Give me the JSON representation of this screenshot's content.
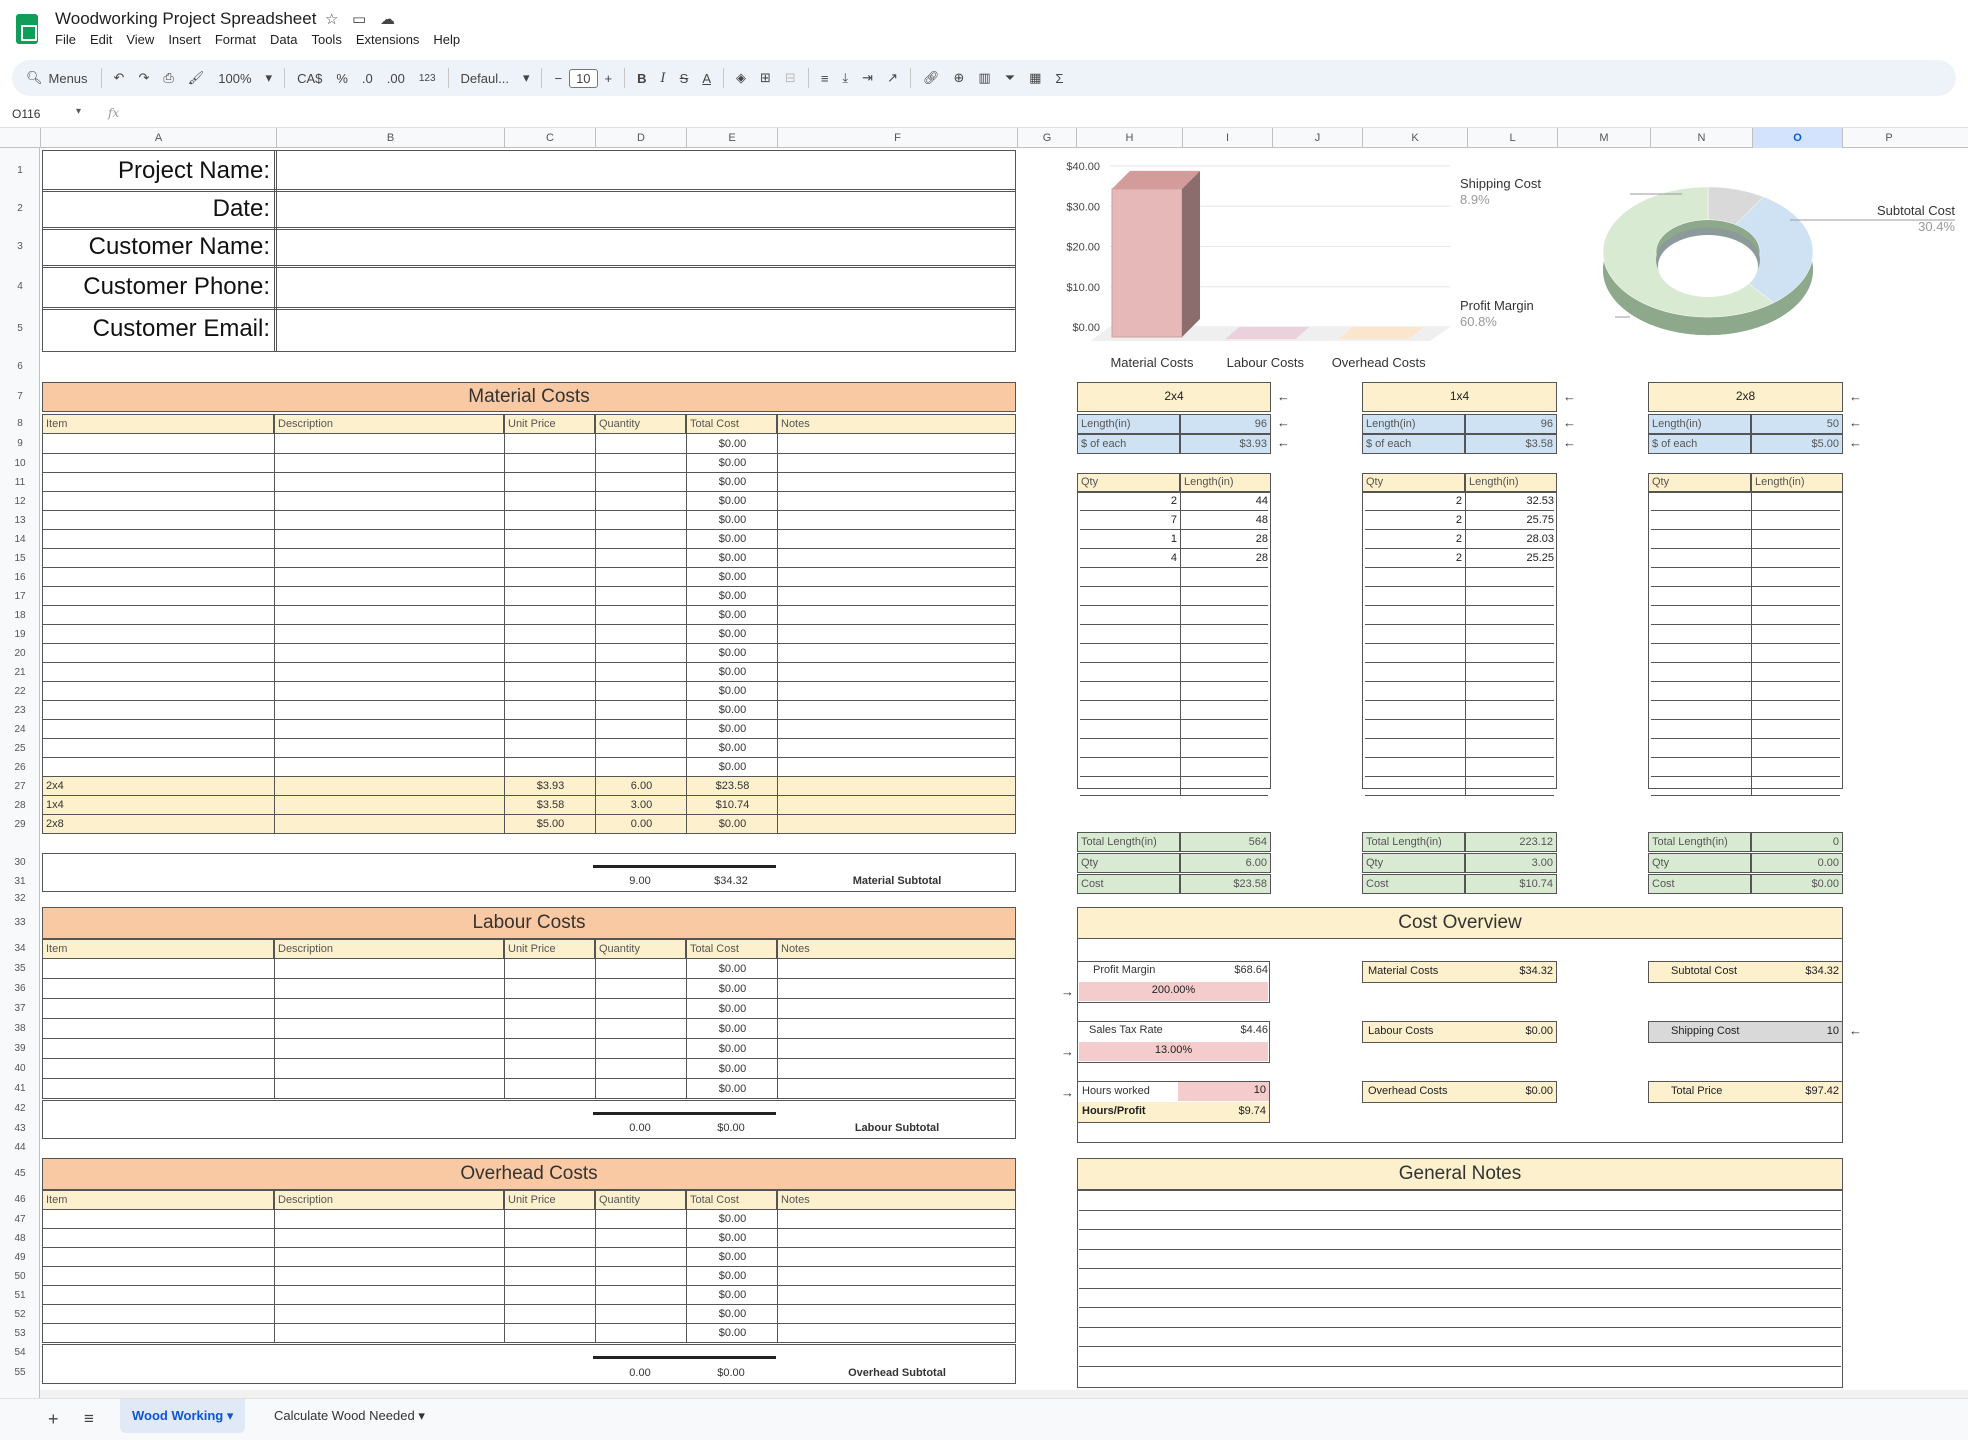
{
  "doc": {
    "title": "Woodworking Project Spreadsheet"
  },
  "menu": [
    "File",
    "Edit",
    "View",
    "Insert",
    "Format",
    "Data",
    "Tools",
    "Extensions",
    "Help"
  ],
  "toolbar": {
    "menus": "Menus",
    "zoom": "100%",
    "currency": "CA$",
    "percent": "%",
    "dec_less": ".0",
    "dec_more": ".00",
    "number_fmt": "123",
    "font": "Defaul...",
    "font_size": "10",
    "bold": "B",
    "italic": "I",
    "strike": "S",
    "textcolor": "A"
  },
  "formula": {
    "namebox": "O116",
    "fx": "fx"
  },
  "columns": [
    "A",
    "B",
    "C",
    "D",
    "E",
    "F",
    "G",
    "H",
    "I",
    "J",
    "K",
    "L",
    "M",
    "N",
    "O",
    "P"
  ],
  "selected_column": "O",
  "rows": [
    "1",
    "2",
    "3",
    "4",
    "5",
    "6",
    "7",
    "8",
    "9",
    "10",
    "11",
    "12",
    "13",
    "14",
    "15",
    "16",
    "17",
    "18",
    "19",
    "20",
    "21",
    "22",
    "23",
    "24",
    "25",
    "26",
    "27",
    "28",
    "29",
    "30",
    "31",
    "32",
    "33",
    "34",
    "35",
    "36",
    "37",
    "38",
    "39",
    "40",
    "41",
    "42",
    "43",
    "44",
    "45",
    "46",
    "47",
    "48",
    "49",
    "50",
    "51",
    "52",
    "53",
    "54",
    "55"
  ],
  "header_fields": [
    "Project Name:",
    "Date:",
    "Customer Name:",
    "Customer Phone:",
    "Customer Email:"
  ],
  "material": {
    "title": "Material Costs",
    "cols": [
      "Item",
      "Description",
      "Unit Price",
      "Quantity",
      "Total Cost",
      "Notes"
    ],
    "zero": "$0.00",
    "wood_rows": [
      {
        "item": "2x4",
        "price": "$3.93",
        "qty": "6.00",
        "total": "$23.58"
      },
      {
        "item": "1x4",
        "price": "$3.58",
        "qty": "3.00",
        "total": "$10.74"
      },
      {
        "item": "2x8",
        "price": "$5.00",
        "qty": "0.00",
        "total": "$0.00"
      }
    ],
    "sub_qty": "9.00",
    "sub_total": "$34.32",
    "sub_label": "Material Subtotal"
  },
  "labour": {
    "title": "Labour Costs",
    "cols": [
      "Item",
      "Description",
      "Unit Price",
      "Quantity",
      "Total Cost",
      "Notes"
    ],
    "zero": "$0.00",
    "sub_qty": "0.00",
    "sub_total": "$0.00",
    "sub_label": "Labour Subtotal"
  },
  "overhead": {
    "title": "Overhead Costs",
    "cols": [
      "Item",
      "Description",
      "Unit Price",
      "Quantity",
      "Total Cost",
      "Notes"
    ],
    "zero": "$0.00",
    "sub_qty": "0.00",
    "sub_total": "$0.00",
    "sub_label": "Overhead Subtotal"
  },
  "lumber": [
    {
      "name": "2x4",
      "length_label": "Length(in)",
      "length": "96",
      "each_label": "$ of each",
      "each": "$3.93",
      "qty_h": "Qty",
      "len_h": "Length(in)",
      "rows": [
        [
          "2",
          "44"
        ],
        [
          "7",
          "48"
        ],
        [
          "1",
          "28"
        ],
        [
          "4",
          "28"
        ]
      ],
      "tl_label": "Total Length(in)",
      "tl": "564",
      "q_label": "Qty",
      "q": "6.00",
      "c_label": "Cost",
      "c": "$23.58"
    },
    {
      "name": "1x4",
      "length_label": "Length(in)",
      "length": "96",
      "each_label": "$ of each",
      "each": "$3.58",
      "qty_h": "Qty",
      "len_h": "Length(in)",
      "rows": [
        [
          "2",
          "32.53"
        ],
        [
          "2",
          "25.75"
        ],
        [
          "2",
          "28.03"
        ],
        [
          "2",
          "25.25"
        ]
      ],
      "tl_label": "Total Length(in)",
      "tl": "223.12",
      "q_label": "Qty",
      "q": "3.00",
      "c_label": "Cost",
      "c": "$10.74"
    },
    {
      "name": "2x8",
      "length_label": "Length(in)",
      "length": "50",
      "each_label": "$ of each",
      "each": "$5.00",
      "qty_h": "Qty",
      "len_h": "Length(in)",
      "rows": [],
      "tl_label": "Total Length(in)",
      "tl": "0",
      "q_label": "Qty",
      "q": "0.00",
      "c_label": "Cost",
      "c": "$0.00"
    }
  ],
  "overview": {
    "title": "Cost Overview",
    "profit_label": "Profit Margin",
    "profit": "$68.64",
    "profit_pct": "200.00%",
    "tax_label": "Sales Tax Rate",
    "tax": "$4.46",
    "tax_pct": "13.00%",
    "hours_label": "Hours worked",
    "hours": "10",
    "hp_label": "Hours/Profit",
    "hp": "$9.74",
    "mat_label": "Material Costs",
    "mat": "$34.32",
    "lab_label": "Labour Costs",
    "lab": "$0.00",
    "ovh_label": "Overhead Costs",
    "ovh": "$0.00",
    "sub_label": "Subtotal Cost",
    "sub": "$34.32",
    "ship_label": "Shipping Cost",
    "ship": "10",
    "total_label": "Total Price",
    "total": "$97.42"
  },
  "notes": {
    "title": "General Notes"
  },
  "chart_data": [
    {
      "type": "bar",
      "categories": [
        "Material Costs",
        "Labour Costs",
        "Overhead Costs"
      ],
      "values": [
        34.32,
        0,
        0
      ],
      "ylim": [
        0,
        40
      ],
      "yticks": [
        "$0.00",
        "$10.00",
        "$20.00",
        "$30.00",
        "$40.00"
      ],
      "colors": [
        "#e6b8b7",
        "#ead1dc",
        "#fce5cd"
      ],
      "grid": true
    },
    {
      "type": "pie",
      "labels": [
        "Shipping Cost",
        "Subtotal Cost",
        "Profit Margin"
      ],
      "pct_labels": [
        "8.9%",
        "30.4%",
        "60.8%"
      ],
      "values": [
        8.9,
        30.4,
        60.8
      ],
      "colors": [
        "#d9d9d9",
        "#cfe2f3",
        "#d9ead3"
      ],
      "style": "donut-3d"
    }
  ],
  "tabs": {
    "active": "Wood Working",
    "other": "Calculate Wood Needed",
    "add": "+",
    "list": "≡"
  }
}
